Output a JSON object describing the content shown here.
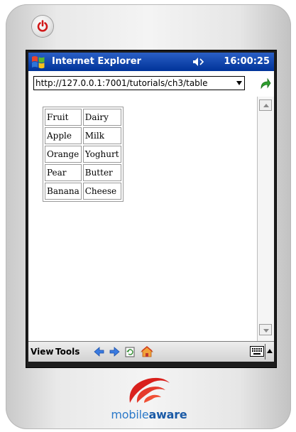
{
  "window": {
    "app_title": "Internet Explorer",
    "clock": "16:00:25"
  },
  "address": {
    "url": "http://127.0.0.1:7001/tutorials/ch3/table"
  },
  "table": {
    "rows": [
      [
        "Fruit",
        "Dairy"
      ],
      [
        "Apple",
        "Milk"
      ],
      [
        "Orange",
        "Yoghurt"
      ],
      [
        "Pear",
        "Butter"
      ],
      [
        "Banana",
        "Cheese"
      ]
    ]
  },
  "menu": {
    "view": "View",
    "tools": "Tools"
  },
  "brand": {
    "prefix": "mobile",
    "suffix": "aware"
  },
  "colors": {
    "titlebar": "#003399",
    "brand_red": "#d9201c",
    "brand_blue": "#1a5aa6"
  },
  "icons": [
    "power-icon",
    "windows-start-icon",
    "speaker-icon",
    "dropdown-icon",
    "go-icon",
    "back-icon",
    "forward-icon",
    "refresh-icon",
    "home-icon",
    "keyboard-icon"
  ]
}
